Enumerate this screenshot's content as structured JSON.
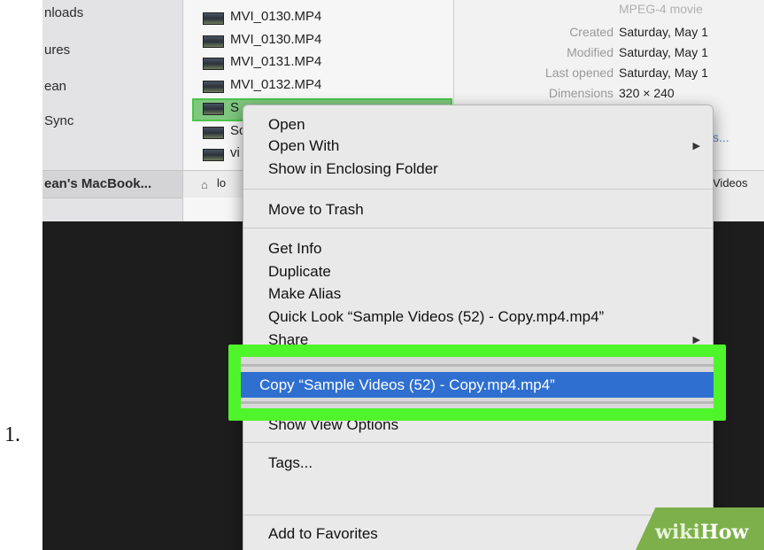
{
  "step_number": "1.",
  "sidebar": {
    "items": [
      "nloads",
      "ures",
      "ean",
      "Sync"
    ],
    "device": "ean's MacBook..."
  },
  "file_list": {
    "files": [
      "MVI_0130.MP4",
      "MVI_0130.MP4",
      "MVI_0131.MP4",
      "MVI_0132.MP4"
    ],
    "partial_items": [
      "S",
      "Sc",
      "vi"
    ]
  },
  "path_bar": {
    "start": "lo",
    "end": "Videos"
  },
  "info": {
    "kind_partial": "MPEG-4 movie",
    "rows": [
      {
        "label": "Created",
        "value": "Saturday, May 1"
      },
      {
        "label": "Modified",
        "value": "Saturday, May 1"
      },
      {
        "label": "Last opened",
        "value": "Saturday, May 1"
      },
      {
        "label": "Dimensions",
        "value": "320 × 240"
      }
    ],
    "more_link": "s..."
  },
  "context_menu": {
    "items": {
      "open": "Open",
      "open_with": "Open With",
      "show_in_folder": "Show in Enclosing Folder",
      "move_to_trash": "Move to Trash",
      "get_info": "Get Info",
      "duplicate": "Duplicate",
      "make_alias": "Make Alias",
      "quick_look": "Quick Look “Sample Videos (52) - Copy.mp4.mp4”",
      "share": "Share",
      "copy": "Copy “Sample Videos (52) - Copy.mp4.mp4”",
      "show_view_options": "Show View Options",
      "tags": "Tags...",
      "add_to_favorites": "Add to Favorites"
    },
    "tag_colors": [
      "#e84a4a",
      "#f39a3a",
      "#e9cf3c",
      "#5cbf4a",
      "#3aa1e6",
      "#b773d9",
      "#9a9a9a"
    ],
    "highlight_color": "#4ff52b",
    "selection_color": "#2f6fd0"
  },
  "watermark": {
    "wiki": "wiki",
    "how": "How"
  }
}
